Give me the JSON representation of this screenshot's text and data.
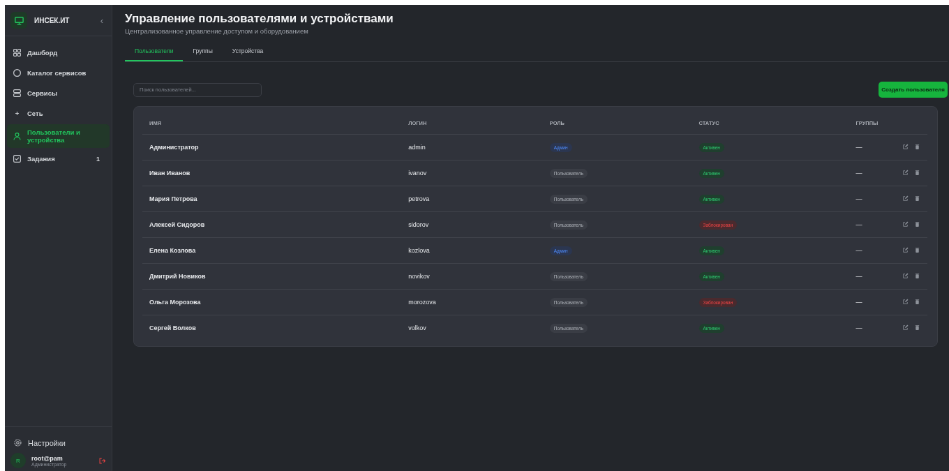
{
  "sidebar": {
    "brand": "ИНСЕК.ИТ",
    "collapse": "‹",
    "items": [
      {
        "label": "Дашборд",
        "kind": "grid",
        "selected": false
      },
      {
        "label": "Каталог сервисов",
        "kind": "circle",
        "selected": false
      },
      {
        "label": "Сервисы",
        "kind": "server",
        "selected": false
      },
      {
        "label": "Сеть",
        "kind": "dot",
        "selected": false
      },
      {
        "label": "Пользователи и устройства",
        "kind": "user",
        "selected": true
      },
      {
        "label": "Задания",
        "kind": "task",
        "selected": false,
        "count": "1"
      }
    ],
    "settings": "Настройки",
    "user": {
      "avatar": "R",
      "name": "root@pam",
      "role": "Администратор"
    }
  },
  "header": {
    "title": "Управление пользователями и устройствами",
    "subtitle": "Централизованное управление доступом и оборудованием"
  },
  "tabs": [
    {
      "label": "Пользователи",
      "selected": true
    },
    {
      "label": "Группы",
      "selected": false
    },
    {
      "label": "Устройства",
      "selected": false
    }
  ],
  "search": {
    "placeholder": "Поиск пользователей..."
  },
  "create_button": "Создать пользователя",
  "table": {
    "columns": [
      "ИМЯ",
      "ЛОГИН",
      "РОЛЬ",
      "СТАТУС",
      "ГРУППЫ"
    ],
    "rows": [
      {
        "name": "Администратор",
        "login": "admin",
        "role": {
          "label": "Админ",
          "kind": "admin"
        },
        "status": {
          "label": "Активен",
          "kind": "active"
        },
        "groups": "—"
      },
      {
        "name": "Иван Иванов",
        "login": "ivanov",
        "role": {
          "label": "Пользователь",
          "kind": "user"
        },
        "status": {
          "label": "Активен",
          "kind": "active"
        },
        "groups": "—"
      },
      {
        "name": "Мария Петрова",
        "login": "petrova",
        "role": {
          "label": "Пользователь",
          "kind": "user"
        },
        "status": {
          "label": "Активен",
          "kind": "active"
        },
        "groups": "—"
      },
      {
        "name": "Алексей Сидоров",
        "login": "sidorov",
        "role": {
          "label": "Пользователь",
          "kind": "user"
        },
        "status": {
          "label": "Заблокирован",
          "kind": "blocked"
        },
        "groups": "—"
      },
      {
        "name": "Елена Козлова",
        "login": "kozlova",
        "role": {
          "label": "Админ",
          "kind": "admin"
        },
        "status": {
          "label": "Активен",
          "kind": "active"
        },
        "groups": "—"
      },
      {
        "name": "Дмитрий Новиков",
        "login": "novikov",
        "role": {
          "label": "Пользователь",
          "kind": "user"
        },
        "status": {
          "label": "Активен",
          "kind": "active"
        },
        "groups": "—"
      },
      {
        "name": "Ольга Морозова",
        "login": "morozova",
        "role": {
          "label": "Пользователь",
          "kind": "user"
        },
        "status": {
          "label": "Заблокирован",
          "kind": "blocked"
        },
        "groups": "—"
      },
      {
        "name": "Сергей Волков",
        "login": "volkov",
        "role": {
          "label": "Пользователь",
          "kind": "user"
        },
        "status": {
          "label": "Активен",
          "kind": "active"
        },
        "groups": "—"
      }
    ]
  }
}
